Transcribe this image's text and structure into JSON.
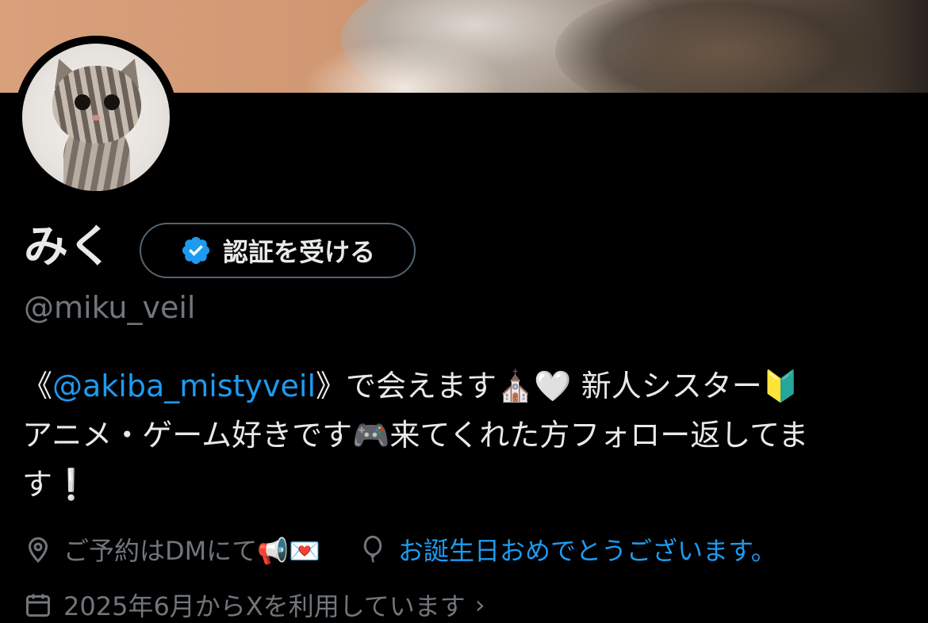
{
  "profile": {
    "name": "みく",
    "verify_label": "認証を受ける",
    "handle": "@miku_veil",
    "bio": {
      "line1_prefix": "《",
      "mention": "@akiba_mistyveil",
      "line1_suffix": "》で会えます⛪🤍 新人シスター🔰",
      "line2": "アニメ・ゲーム好きです🎮来てくれた方フォロー返してま",
      "line3": "す❕"
    },
    "location": "ご予約はDMにて📢💌",
    "birthday": "お誕生日おめでとうございます。",
    "joined": "2025年6月からXを利用しています",
    "joined_chevron": "›"
  },
  "colors": {
    "background": "#000000",
    "text": "#e7e9ea",
    "secondary": "#71767b",
    "accent": "#1d9bf0"
  },
  "icons": {
    "verified": "verified-badge-icon",
    "location": "location-pin-icon",
    "birthday": "balloon-icon",
    "joined": "calendar-icon"
  }
}
